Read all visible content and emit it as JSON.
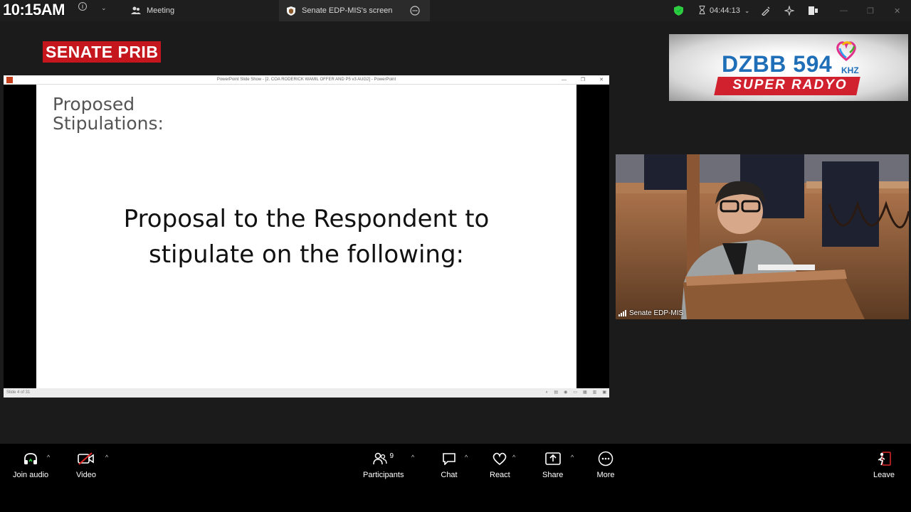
{
  "overlay": {
    "clock": "10:15AM",
    "channel_badge": "SENATE PRIB"
  },
  "broadcast_logo": {
    "title": "DZBB 594",
    "unit": "KHZ",
    "tagline": "SUPER RADYO"
  },
  "topbar": {
    "tab_meeting": "Meeting",
    "tab_screen": "Senate EDP-MIS's screen",
    "timer": "04:44:13"
  },
  "shared_screen": {
    "window_title": "PowerPoint Slide Show - [2. COA RODERICK WAMIL OFFER AND P5 v3 AUG2] - PowerPoint",
    "slide_heading": [
      "Proposed",
      "Stipulations:"
    ],
    "slide_body": [
      "Proposal to the Respondent to",
      "stipulate on the following:"
    ],
    "status_left": "Slide 4 of 31"
  },
  "video_tile": {
    "participant_name": "Senate EDP-MIS"
  },
  "toolbar": {
    "join_audio": "Join audio",
    "video": "Video",
    "participants": "Participants",
    "participants_count": "9",
    "chat": "Chat",
    "react": "React",
    "share": "Share",
    "more": "More",
    "leave": "Leave"
  },
  "colors": {
    "badge_red": "#c4161c",
    "logo_blue": "#1f6fb8",
    "shield_green": "#2ecc40",
    "leave_red": "#e02828"
  }
}
